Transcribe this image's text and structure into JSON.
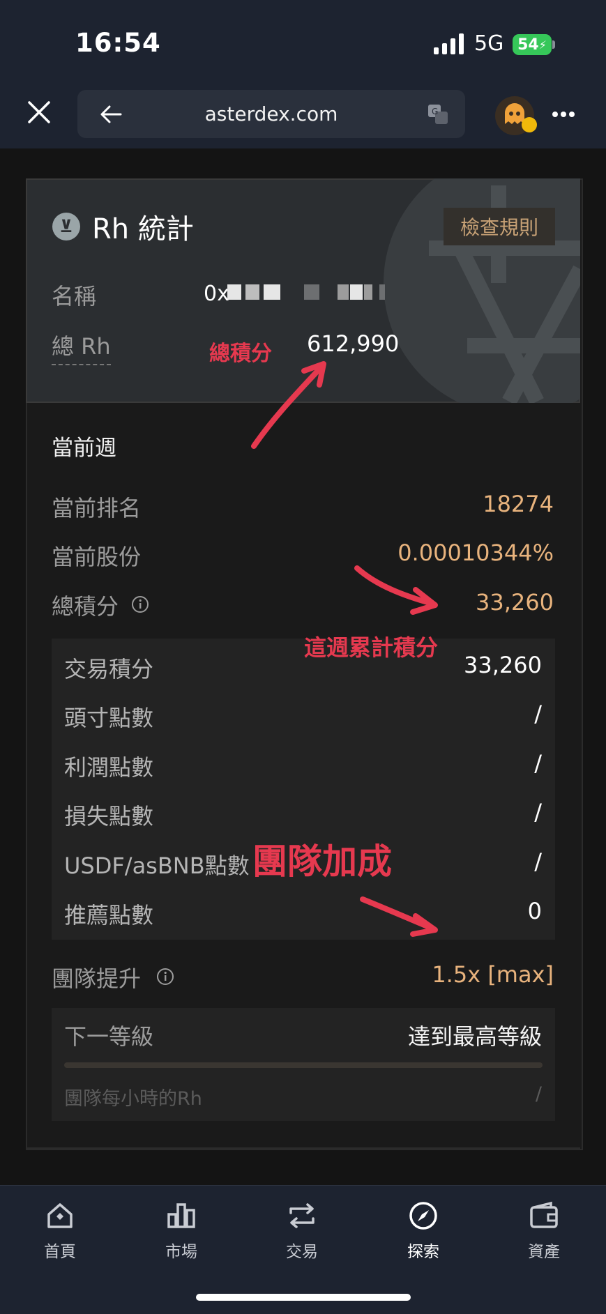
{
  "status_bar": {
    "time": "16:54",
    "network": "5G",
    "battery": "54"
  },
  "browser": {
    "url": "asterdex.com"
  },
  "stats_card": {
    "title": "Rh 統計",
    "rules_button": "檢查規則",
    "name_label": "名稱",
    "name_value_prefix": "0x",
    "total_label": "總 Rh",
    "total_value": "612,990"
  },
  "current_week": {
    "title": "當前週",
    "rows": [
      {
        "label": "當前排名",
        "value": "18274"
      },
      {
        "label": "當前股份",
        "value": "0.00010344%"
      },
      {
        "label": "總積分",
        "value": "33,260"
      }
    ]
  },
  "points_breakdown": [
    {
      "label": "交易積分",
      "value": "33,260"
    },
    {
      "label": "頭寸點數",
      "value": "/"
    },
    {
      "label": "利潤點數",
      "value": "/"
    },
    {
      "label": "損失點數",
      "value": "/"
    },
    {
      "label": "USDF/asBNB點數",
      "value": "/"
    },
    {
      "label": "推薦點數",
      "value": "0"
    }
  ],
  "team_boost": {
    "label": "團隊提升",
    "value": "1.5x [max]"
  },
  "level": {
    "next_label": "下一等級",
    "next_value": "達到最高等級",
    "hourly_label": "團隊每小時的Rh",
    "hourly_value": "/"
  },
  "annotations": {
    "total_points": "總積分",
    "week_cumulative": "這週累計積分",
    "team_bonus": "團隊加成"
  },
  "bottom_nav": [
    {
      "label": "首頁",
      "icon": "home-icon"
    },
    {
      "label": "市場",
      "icon": "market-icon"
    },
    {
      "label": "交易",
      "icon": "trade-icon"
    },
    {
      "label": "探索",
      "icon": "explore-icon",
      "active": true
    },
    {
      "label": "資產",
      "icon": "wallet-icon"
    }
  ],
  "colors": {
    "accent": "#e8b37d",
    "annotation": "#e6394f",
    "background": "#141414"
  }
}
